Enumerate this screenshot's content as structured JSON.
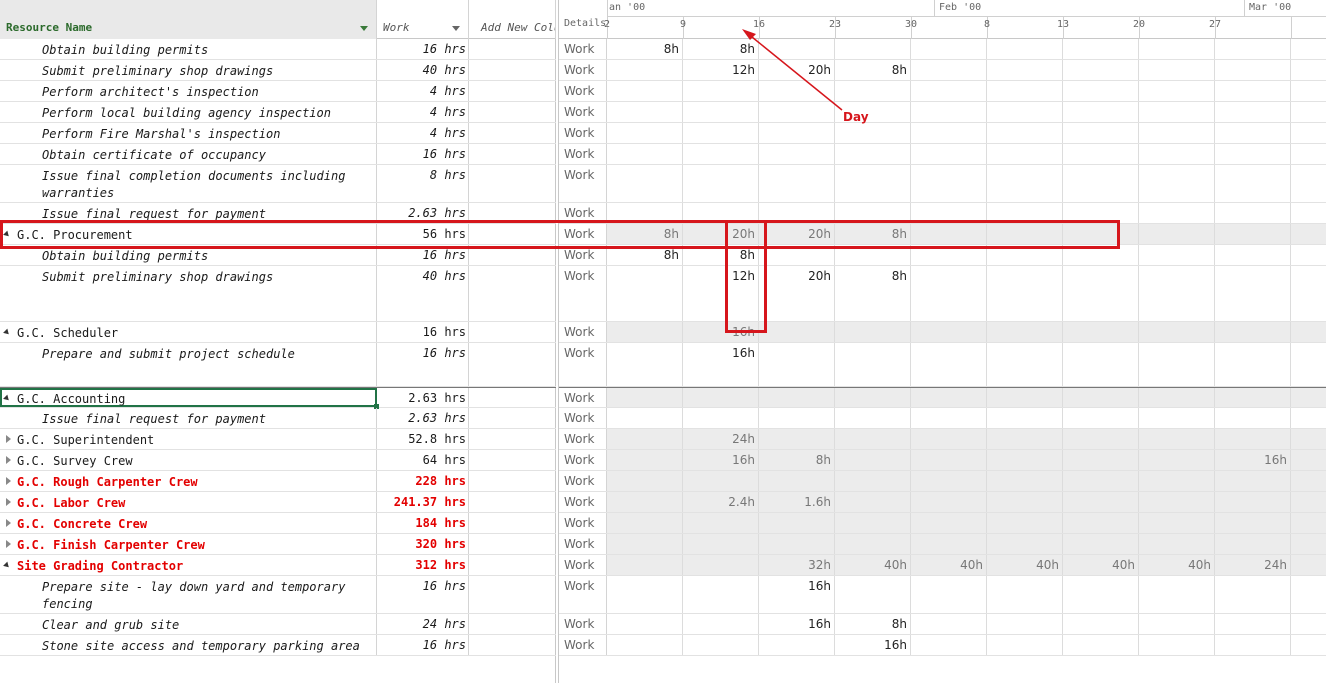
{
  "header": {
    "resource_name": "Resource Name",
    "work": "Work",
    "add_new_column": "Add New Colu",
    "details": "Details",
    "months": [
      "an '00",
      "Feb '00",
      "Mar '00"
    ],
    "days": [
      "2",
      "9",
      "16",
      "23",
      "30",
      "8",
      "13",
      "20",
      "27"
    ]
  },
  "rows": [
    {
      "kind": "assign",
      "name": "Obtain building permits",
      "work": "16 hrs",
      "detail": "Work",
      "cells": [
        "8h",
        "8h",
        "",
        "",
        "",
        "",
        "",
        "",
        ""
      ]
    },
    {
      "kind": "assign",
      "name": "Submit preliminary shop drawings",
      "work": "40 hrs",
      "detail": "Work",
      "cells": [
        "",
        "12h",
        "20h",
        "8h",
        "",
        "",
        "",
        "",
        ""
      ]
    },
    {
      "kind": "assign",
      "name": "Perform architect's inspection",
      "work": "4 hrs",
      "detail": "Work",
      "cells": [
        "",
        "",
        "",
        "",
        "",
        "",
        "",
        "",
        ""
      ]
    },
    {
      "kind": "assign",
      "name": "Perform local building agency inspection",
      "work": "4 hrs",
      "detail": "Work",
      "cells": [
        "",
        "",
        "",
        "",
        "",
        "",
        "",
        "",
        ""
      ]
    },
    {
      "kind": "assign",
      "name": "Perform Fire Marshal's inspection",
      "work": "4 hrs",
      "detail": "Work",
      "cells": [
        "",
        "",
        "",
        "",
        "",
        "",
        "",
        "",
        ""
      ]
    },
    {
      "kind": "assign",
      "name": "Obtain certificate of occupancy",
      "work": "16 hrs",
      "detail": "Work",
      "cells": [
        "",
        "",
        "",
        "",
        "",
        "",
        "",
        "",
        ""
      ]
    },
    {
      "kind": "assign",
      "name": "Issue final completion documents including warranties",
      "work": "8 hrs",
      "detail": "Work",
      "cells": [
        "",
        "",
        "",
        "",
        "",
        "",
        "",
        "",
        ""
      ]
    },
    {
      "kind": "assign",
      "name": "Issue final request for payment",
      "work": "2.63 hrs",
      "detail": "Work",
      "cells": [
        "",
        "",
        "",
        "",
        "",
        "",
        "",
        "",
        ""
      ]
    },
    {
      "kind": "res",
      "toggle": "expanded",
      "name": "G.C. Procurement",
      "work": "56 hrs",
      "detail": "Work",
      "cells": [
        "8h",
        "20h",
        "20h",
        "8h",
        "",
        "",
        "",
        "",
        ""
      ]
    },
    {
      "kind": "assign",
      "name": "Obtain building permits",
      "work": "16 hrs",
      "detail": "Work",
      "cells": [
        "8h",
        "8h",
        "",
        "",
        "",
        "",
        "",
        "",
        ""
      ]
    },
    {
      "kind": "assign",
      "name": "Submit preliminary shop drawings",
      "work": "40 hrs",
      "detail": "Work",
      "cells": [
        "",
        "12h",
        "20h",
        "8h",
        "",
        "",
        "",
        "",
        ""
      ]
    },
    {
      "kind": "res",
      "toggle": "expanded",
      "name": "G.C. Scheduler",
      "work": "16 hrs",
      "detail": "Work",
      "cells": [
        "",
        "16h",
        "",
        "",
        "",
        "",
        "",
        "",
        ""
      ]
    },
    {
      "kind": "assign",
      "name": "Prepare and submit project schedule",
      "work": "16 hrs",
      "detail": "Work",
      "cells": [
        "",
        "16h",
        "",
        "",
        "",
        "",
        "",
        "",
        ""
      ]
    },
    {
      "kind": "res",
      "toggle": "expanded",
      "name": "G.C. Accounting",
      "work": "2.63 hrs",
      "detail": "Work",
      "cells": [
        "",
        "",
        "",
        "",
        "",
        "",
        "",
        "",
        ""
      ]
    },
    {
      "kind": "assign",
      "name": "Issue final request for payment",
      "work": "2.63 hrs",
      "detail": "Work",
      "cells": [
        "",
        "",
        "",
        "",
        "",
        "",
        "",
        "",
        ""
      ]
    },
    {
      "kind": "res",
      "toggle": "collapsed",
      "name": "G.C. Superintendent",
      "work": "52.8 hrs",
      "detail": "Work",
      "cells": [
        "",
        "24h",
        "",
        "",
        "",
        "",
        "",
        "",
        ""
      ]
    },
    {
      "kind": "res",
      "toggle": "collapsed",
      "name": "G.C. Survey Crew",
      "work": "64 hrs",
      "detail": "Work",
      "cells": [
        "",
        "16h",
        "8h",
        "",
        "",
        "",
        "",
        "",
        "16h"
      ]
    },
    {
      "kind": "res",
      "toggle": "collapsed",
      "over": true,
      "name": "G.C. Rough Carpenter Crew",
      "work": "228 hrs",
      "detail": "Work",
      "cells": [
        "",
        "",
        "",
        "",
        "",
        "",
        "",
        "",
        ""
      ]
    },
    {
      "kind": "res",
      "toggle": "collapsed",
      "over": true,
      "name": "G.C. Labor Crew",
      "work": "241.37 hrs",
      "detail": "Work",
      "cells": [
        "",
        "2.4h",
        "1.6h",
        "",
        "",
        "",
        "",
        "",
        ""
      ]
    },
    {
      "kind": "res",
      "toggle": "collapsed",
      "over": true,
      "name": "G.C. Concrete Crew",
      "work": "184 hrs",
      "detail": "Work",
      "cells": [
        "",
        "",
        "",
        "",
        "",
        "",
        "",
        "",
        ""
      ]
    },
    {
      "kind": "res",
      "toggle": "collapsed",
      "over": true,
      "name": "G.C. Finish Carpenter Crew",
      "work": "320 hrs",
      "detail": "Work",
      "cells": [
        "",
        "",
        "",
        "",
        "",
        "",
        "",
        "",
        ""
      ]
    },
    {
      "kind": "res",
      "toggle": "expanded",
      "over": true,
      "name": "Site Grading Contractor",
      "work": "312 hrs",
      "detail": "Work",
      "cells": [
        "",
        "",
        "32h",
        "40h",
        "40h",
        "40h",
        "40h",
        "40h",
        "24h"
      ]
    },
    {
      "kind": "assign",
      "name": "Prepare site - lay down yard and temporary fencing",
      "work": "16 hrs",
      "detail": "Work",
      "cells": [
        "",
        "",
        "16h",
        "",
        "",
        "",
        "",
        "",
        ""
      ]
    },
    {
      "kind": "assign",
      "name": "Clear and grub site",
      "work": "24 hrs",
      "detail": "Work",
      "cells": [
        "",
        "",
        "16h",
        "8h",
        "",
        "",
        "",
        "",
        ""
      ]
    },
    {
      "kind": "assign",
      "name": "Stone site access and temporary parking area",
      "work": "16 hrs",
      "detail": "Work",
      "cells": [
        "",
        "",
        "",
        "16h",
        "",
        "",
        "",
        "",
        ""
      ]
    }
  ],
  "annotation": {
    "label": "Day",
    "color": "#d6161c"
  },
  "colors": {
    "overallocated": "#e30000",
    "header_green": "#2b6a2b",
    "selection": "#217346"
  }
}
